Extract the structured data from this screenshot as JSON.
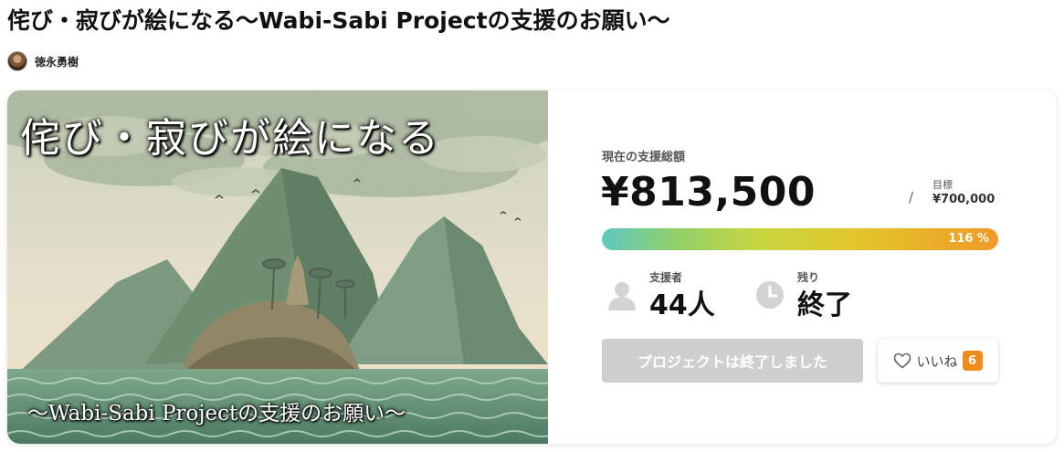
{
  "page": {
    "title": "侘び・寂びが絵になる〜Wabi-Sabi Projectの支援のお願い〜",
    "author": "徳永勇樹"
  },
  "hero": {
    "title": "侘び・寂びが絵になる",
    "subtitle": "〜Wabi-Sabi Projectの支援のお願い〜"
  },
  "funding": {
    "raised_label": "現在の支援総額",
    "raised_amount": "¥813,500",
    "goal_separator": "/",
    "goal_label": "目標",
    "goal_amount": "¥700,000",
    "progress_text": "116 %",
    "progress_fraction": 1.16,
    "gradient_colors": [
      "#5ec8c0",
      "#8fd06c",
      "#c8d640",
      "#e3c52a",
      "#ef9a27"
    ]
  },
  "stats": {
    "supporters_label": "支援者",
    "supporters_value": "44人",
    "remaining_label": "残り",
    "remaining_value": "終了",
    "supporters_icon": "person-icon",
    "remaining_icon": "clock-icon"
  },
  "actions": {
    "ended_label": "プロジェクトは終了しました",
    "like_label": "いいね",
    "like_count": "6",
    "like_icon": "heart-icon",
    "accent_color": "#f08c1c",
    "disabled_color": "#cfcfcf"
  }
}
